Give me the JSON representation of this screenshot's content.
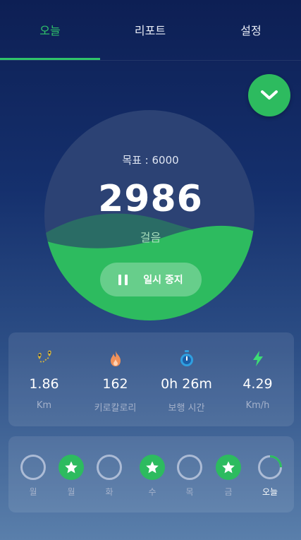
{
  "tabs": [
    {
      "label": "오늘",
      "active": true
    },
    {
      "label": "리포트",
      "active": false
    },
    {
      "label": "설정",
      "active": false
    }
  ],
  "progress": {
    "goal_text": "목표 : 6000",
    "steps": "2986",
    "steps_unit": "걸음",
    "fill_fraction": 0.4977,
    "pause_label": "일시 중지"
  },
  "stats": [
    {
      "icon": "route-icon",
      "value": "1.86",
      "label": "Km"
    },
    {
      "icon": "flame-icon",
      "value": "162",
      "label": "키로칼로리"
    },
    {
      "icon": "stopwatch-icon",
      "value": "0h 26m",
      "label": "보행 시간"
    },
    {
      "icon": "lightning-icon",
      "value": "4.29",
      "label": "Km/h"
    }
  ],
  "week": [
    {
      "label": "월",
      "status": "empty"
    },
    {
      "label": "월",
      "status": "star"
    },
    {
      "label": "화",
      "status": "empty"
    },
    {
      "label": "수",
      "status": "star"
    },
    {
      "label": "목",
      "status": "empty"
    },
    {
      "label": "금",
      "status": "star"
    },
    {
      "label": "오늘",
      "status": "partial",
      "today": true
    }
  ],
  "colors": {
    "accent": "#2dbb5f",
    "active_tab": "#2fc46a",
    "route_icon": "#d8b63a",
    "flame_icon": "#f0915a",
    "stopwatch_icon": "#2f9fe0",
    "lightning_icon": "#3ddc74"
  }
}
